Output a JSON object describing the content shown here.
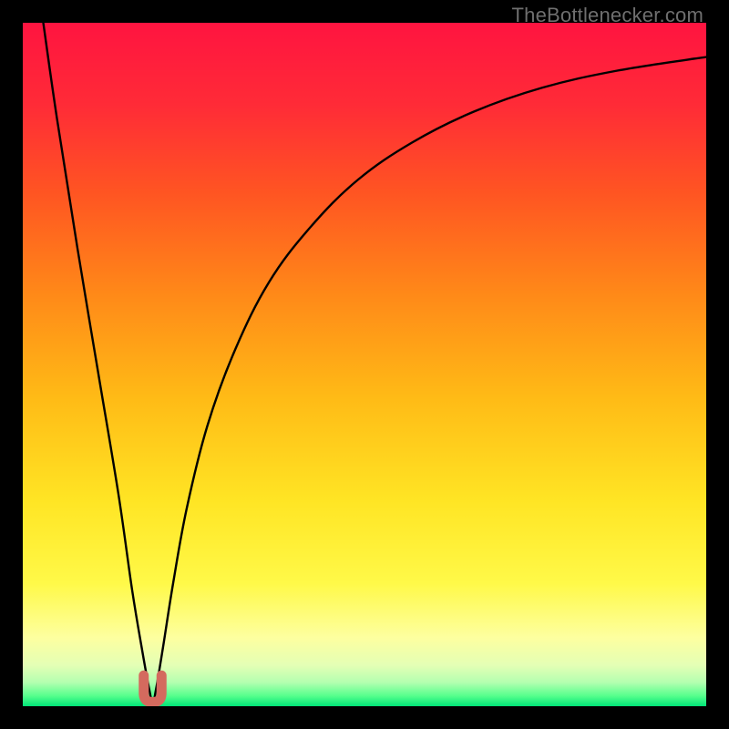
{
  "watermark": "TheBottlenecker.com",
  "gradient_stops": [
    {
      "offset": 0.0,
      "color": "#ff1440"
    },
    {
      "offset": 0.12,
      "color": "#ff2b37"
    },
    {
      "offset": 0.25,
      "color": "#ff5522"
    },
    {
      "offset": 0.4,
      "color": "#ff8a18"
    },
    {
      "offset": 0.55,
      "color": "#ffbb16"
    },
    {
      "offset": 0.7,
      "color": "#ffe524"
    },
    {
      "offset": 0.82,
      "color": "#fff948"
    },
    {
      "offset": 0.9,
      "color": "#fdffa0"
    },
    {
      "offset": 0.94,
      "color": "#e4ffb5"
    },
    {
      "offset": 0.965,
      "color": "#b4ffb0"
    },
    {
      "offset": 0.985,
      "color": "#55ff8c"
    },
    {
      "offset": 1.0,
      "color": "#00e478"
    }
  ],
  "marker": {
    "color_fill": "#d46a5e",
    "color_stroke": "#b84f44"
  },
  "chart_data": {
    "type": "line",
    "title": "",
    "xlabel": "",
    "ylabel": "",
    "xlim": [
      0,
      100
    ],
    "ylim": [
      0,
      100
    ],
    "x_optimum": 19,
    "series": [
      {
        "name": "bottleneck-curve",
        "x": [
          3,
          5,
          8,
          11,
          14,
          16,
          17.5,
          18.5,
          19,
          19.5,
          20.5,
          22,
          24,
          27,
          31,
          36,
          42,
          49,
          57,
          66,
          76,
          87,
          100
        ],
        "y": [
          100,
          86,
          67,
          49,
          31,
          17,
          8,
          2.5,
          0.5,
          2.5,
          8.5,
          18,
          29,
          41,
          52,
          62,
          70,
          77,
          82.5,
          87,
          90.5,
          93,
          95
        ]
      }
    ],
    "marker_region": {
      "x0": 17.7,
      "x1": 20.3,
      "y_top": 4.5
    }
  }
}
